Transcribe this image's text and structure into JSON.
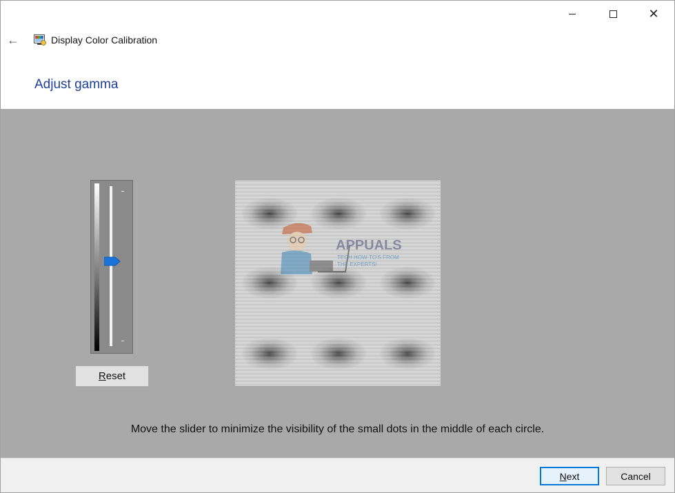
{
  "window": {
    "title": "Display Color Calibration",
    "controls": {
      "minimize": "minimize-icon",
      "maximize": "maximize-icon",
      "close": "close-icon",
      "close_glyph": "✕"
    }
  },
  "header": {
    "back_icon": "back-arrow-icon",
    "back_glyph": "←",
    "app_icon": "display-color-calibration-icon",
    "heading": "Adjust gamma"
  },
  "gamma": {
    "slider": {
      "value_fraction": 0.47,
      "thumb_color": "#1a73d9",
      "track_color": "#f2f2f2"
    },
    "reset_button": {
      "label": "Reset",
      "access_key": "R",
      "rest": "eset"
    },
    "sample_image": "gamma-calibration-pattern",
    "watermark": {
      "name": "APPUALS",
      "tagline_line1": "TECH HOW-TO'S FROM",
      "tagline_line2": "THE EXPERTS!"
    },
    "instruction": "Move the slider to minimize the visibility of the small dots in the middle of each circle."
  },
  "footer": {
    "next_button": {
      "label": "Next",
      "access_key": "N",
      "rest": "ext"
    },
    "cancel_button": {
      "label": "Cancel"
    }
  },
  "colors": {
    "heading": "#1d3f99",
    "panel_bg": "#a9a9a9",
    "accent": "#0078d7"
  }
}
